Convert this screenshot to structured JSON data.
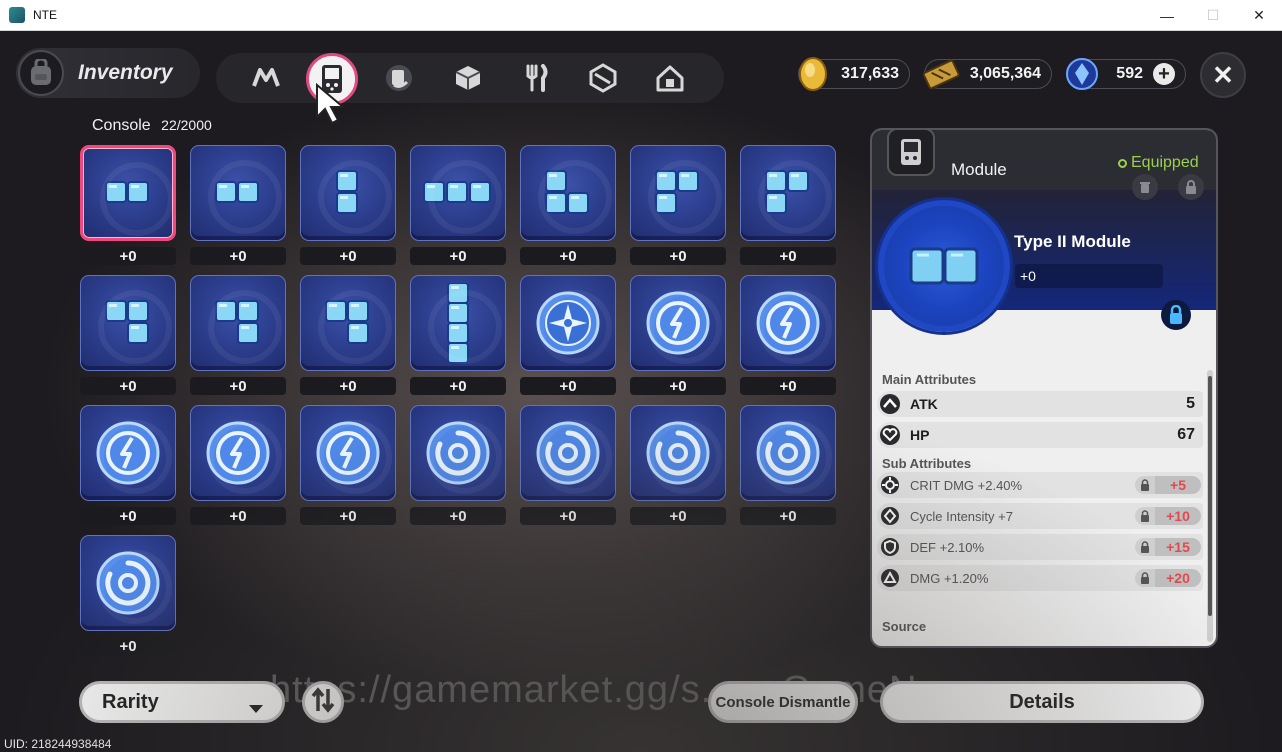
{
  "window": {
    "title": "NTE",
    "minimize": "—",
    "maximize": "☐",
    "close": "✕"
  },
  "header": {
    "inventory_label": "Inventory",
    "tabs": [
      {
        "icon": "n-logo-icon"
      },
      {
        "icon": "console-icon",
        "active": true
      },
      {
        "icon": "book-icon"
      },
      {
        "icon": "box-icon"
      },
      {
        "icon": "fork-knife-icon"
      },
      {
        "icon": "gift-box-icon"
      },
      {
        "icon": "home-icon"
      }
    ],
    "currencies": [
      {
        "icon": "gold-coin-icon",
        "value": "317,633"
      },
      {
        "icon": "ticket-icon",
        "value": "3,065,364"
      },
      {
        "icon": "crystal-icon",
        "value": "592",
        "plus": "+"
      }
    ],
    "close": "✕"
  },
  "console": {
    "label": "Console",
    "count": "22/2000"
  },
  "items": [
    {
      "icon": "block-2h",
      "level": "+0",
      "selected": true
    },
    {
      "icon": "block-2h",
      "level": "+0"
    },
    {
      "icon": "block-2v",
      "level": "+0"
    },
    {
      "icon": "block-3h",
      "level": "+0"
    },
    {
      "icon": "block-l",
      "level": "+0"
    },
    {
      "icon": "block-r",
      "level": "+0"
    },
    {
      "icon": "block-r",
      "level": "+0"
    },
    {
      "icon": "block-j",
      "level": "+0"
    },
    {
      "icon": "block-j",
      "level": "+0"
    },
    {
      "icon": "block-j",
      "level": "+0"
    },
    {
      "icon": "block-4v",
      "level": "+0"
    },
    {
      "icon": "compass-disc",
      "level": "+0"
    },
    {
      "icon": "bolt-disc",
      "level": "+0"
    },
    {
      "icon": "bolt-disc",
      "level": "+0"
    },
    {
      "icon": "bolt-disc",
      "level": "+0"
    },
    {
      "icon": "bolt-disc",
      "level": "+0"
    },
    {
      "icon": "bolt-disc",
      "level": "+0"
    },
    {
      "icon": "ring-disc",
      "level": "+0"
    },
    {
      "icon": "ring-disc",
      "level": "+0"
    },
    {
      "icon": "ring-disc",
      "level": "+0"
    },
    {
      "icon": "ring-disc",
      "level": "+0"
    },
    {
      "icon": "ring-disc",
      "level": "+0"
    }
  ],
  "panel": {
    "category": "Module",
    "equipped": "Equipped",
    "name": "Type II Module",
    "level": "+0",
    "main_title": "Main Attributes",
    "main": [
      {
        "icon": "atk-icon",
        "name": "ATK",
        "value": "5"
      },
      {
        "icon": "hp-icon",
        "name": "HP",
        "value": "67"
      }
    ],
    "sub_title": "Sub Attributes",
    "sub": [
      {
        "icon": "crit-icon",
        "name": "CRIT DMG +2.40%",
        "add": "+5"
      },
      {
        "icon": "cycle-icon",
        "name": "Cycle Intensity +7",
        "add": "+10"
      },
      {
        "icon": "def-icon",
        "name": "DEF +2.10%",
        "add": "+15"
      },
      {
        "icon": "dmg-icon",
        "name": "DMG +1.20%",
        "add": "+20"
      }
    ],
    "source_title": "Source"
  },
  "bottom": {
    "rarity": "Rarity",
    "dismantle": "Console Dismantle",
    "details": "Details",
    "watermark": "https://gamemarket.gg/s... ...GameNew..."
  },
  "uid": "UID: 218244938484",
  "colors": {
    "selected_border": "#f1477f",
    "equipped": "#9ad04f",
    "sub_add": "#e5484d",
    "card_blue": "#2d3f8f"
  }
}
